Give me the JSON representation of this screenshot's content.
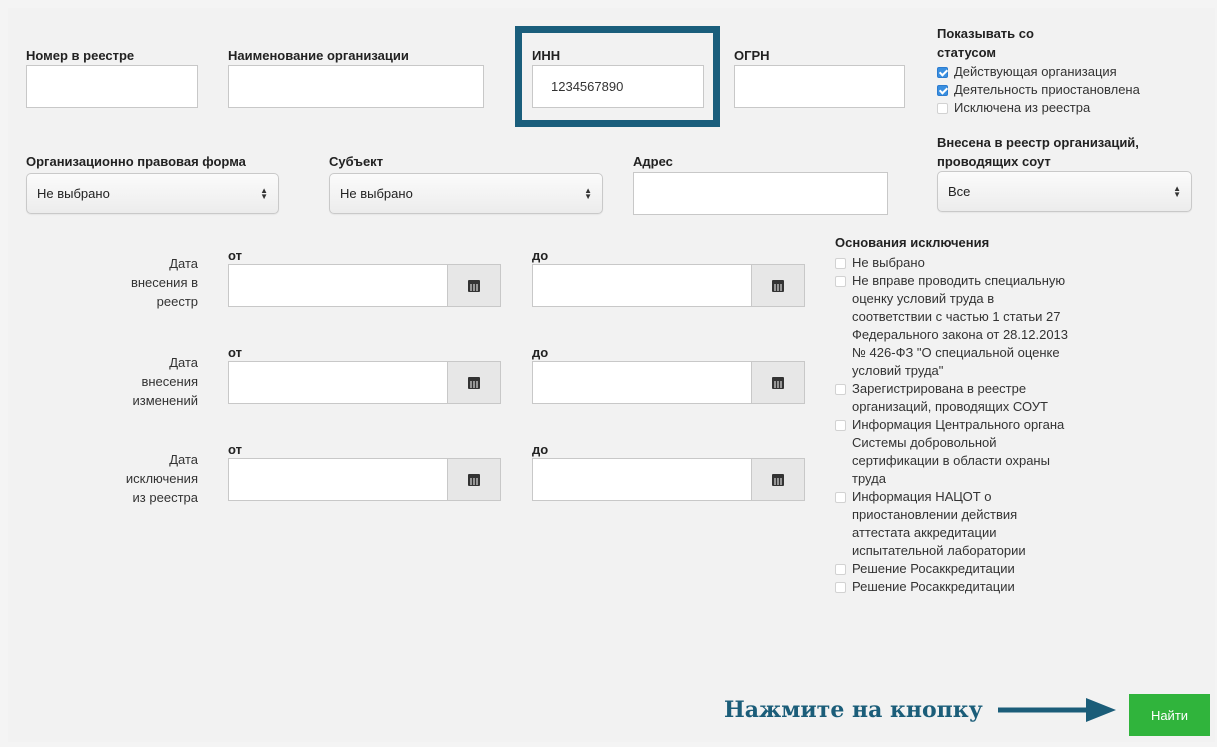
{
  "fields": {
    "reg_number": {
      "label": "Номер в реестре",
      "value": ""
    },
    "org_name": {
      "label": "Наименование организации",
      "value": ""
    },
    "inn": {
      "label": "ИНН",
      "value": "1234567890"
    },
    "ogrn": {
      "label": "ОГРН",
      "value": ""
    },
    "legal_form": {
      "label": "Организационно правовая форма",
      "value": "Не выбрано"
    },
    "subject": {
      "label": "Субъект",
      "value": "Не выбрано"
    },
    "address": {
      "label": "Адрес",
      "value": ""
    },
    "sout_registry": {
      "label_line1": "Внесена в реестр организаций,",
      "label_line2": "проводящих соут",
      "value": "Все"
    }
  },
  "status": {
    "title_line1": "Показывать со",
    "title_line2": "статусом",
    "options": [
      {
        "label": "Действующая организация",
        "checked": true
      },
      {
        "label": "Деятельность приостановлена",
        "checked": true
      },
      {
        "label": "Исключена из реестра",
        "checked": false
      }
    ]
  },
  "dates": {
    "from_label": "от",
    "to_label": "до",
    "rows": [
      {
        "line1": "Дата",
        "line2": "внесения в",
        "line3": "реестр"
      },
      {
        "line1": "Дата",
        "line2": "внесения",
        "line3": "изменений"
      },
      {
        "line1": "Дата",
        "line2": "исключения",
        "line3": "из реестра"
      }
    ]
  },
  "exclusion": {
    "title": "Основания исключения",
    "options": [
      {
        "lines": [
          "Не выбрано"
        ]
      },
      {
        "lines": [
          "Не вправе проводить специальную",
          "оценку условий труда в",
          "соответствии с частью 1 статьи 27",
          "Федерального закона от 28.12.2013",
          "№ 426-ФЗ \"О специальной оценке",
          "условий труда\""
        ]
      },
      {
        "lines": [
          "Зарегистрирована в реестре",
          "организаций, проводящих СОУТ"
        ]
      },
      {
        "lines": [
          "Информация Центрального органа",
          "Системы добровольной",
          "сертификации в области охраны",
          "труда"
        ]
      },
      {
        "lines": [
          "Информация НАЦОТ о",
          "приостановлении действия",
          "аттестата аккредитации",
          "испытательной лаборатории"
        ]
      },
      {
        "lines": [
          "Решение Росаккредитации"
        ]
      },
      {
        "lines": [
          "Решение Росаккредитации"
        ]
      }
    ]
  },
  "footer": {
    "hint": "Нажмите на кнопку",
    "find_label": "Найти"
  },
  "colors": {
    "highlight": "#1a5e7c",
    "find_button": "#30b43c",
    "checkbox_checked": "#3a8fe0"
  }
}
